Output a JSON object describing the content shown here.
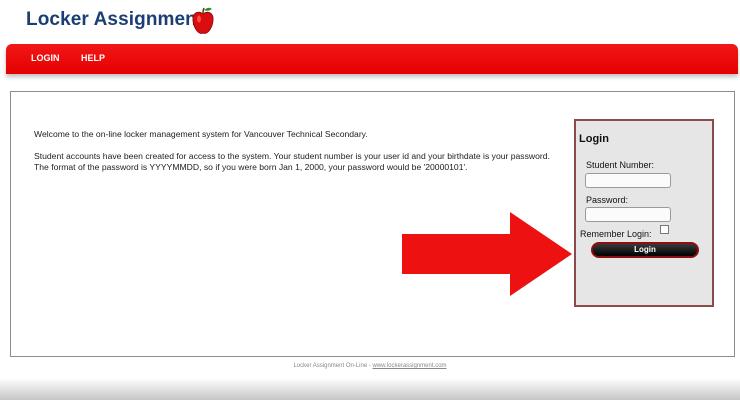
{
  "header": {
    "title": "Locker Assignment",
    "logo_icon": "apple-icon"
  },
  "nav": {
    "items": [
      {
        "label": "LOGIN"
      },
      {
        "label": "HELP"
      }
    ],
    "color": "#e60000"
  },
  "main": {
    "welcome": "Welcome to the on-line locker management system for Vancouver Technical Secondary.",
    "instructions": "Student accounts have been created for access to the system. Your student number is your user id and your birthdate is your password. The format of the password is YYYYMMDD, so if you were born Jan 1, 2000, your password would be '20000101'.",
    "arrow_icon": "right-arrow-icon"
  },
  "login_form": {
    "title": "Login",
    "student_number_label": "Student Number:",
    "student_number_value": "",
    "password_label": "Password:",
    "password_value": "",
    "remember_label": "Remember Login:",
    "remember_checked": false,
    "button_label": "Login"
  },
  "footer": {
    "text": "Locker Assignment On-Line - ",
    "link": "www.lockerassignment.com"
  }
}
